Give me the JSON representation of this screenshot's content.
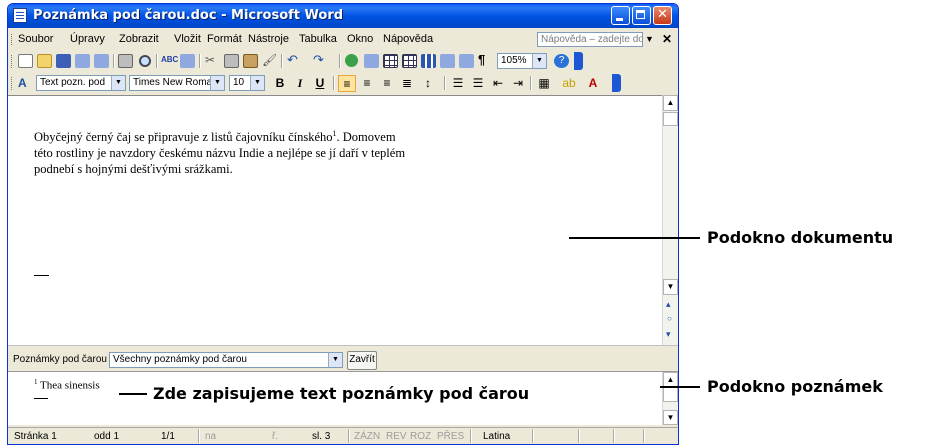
{
  "window": {
    "title": "Poznámka pod čarou.doc - Microsoft Word"
  },
  "menubar": {
    "items": [
      "Soubor",
      "Úpravy",
      "Zobrazit",
      "Vložit",
      "Formát",
      "Nástroje",
      "Tabulka",
      "Okno",
      "Nápověda"
    ],
    "help_placeholder": "Nápověda – zadejte dotaz"
  },
  "toolbar_standard": {
    "zoom": "105%"
  },
  "toolbar_formatting": {
    "style": "Text pozn. pod",
    "font": "Times New Roman",
    "size": "10",
    "bold": "B",
    "italic": "I",
    "underline": "U"
  },
  "document": {
    "line1_a": "Obyčejný černý čaj se připravuje z listů čajovníku čínského",
    "footnote_ref": "1",
    "line1_b": ". Domovem",
    "line2": "této rostliny je navzdory českému názvu Indie a nejlépe se jí daří v teplém",
    "line3": "podnebí s hojnými dešťivými srážkami."
  },
  "footnote_bar": {
    "label": "Poznámky pod čarou",
    "selector_value": "Všechny poznámky pod čarou",
    "close_label": "Zavřít"
  },
  "footnote_pane": {
    "number": "1",
    "text": " Thea sinensis"
  },
  "statusbar": {
    "page": "Stránka 1",
    "section": "odd 1",
    "pages": "1/1",
    "at": "na",
    "line": "ř.",
    "column": "sl. 3",
    "rec": "ZÁZN",
    "trk": "REV",
    "ext": "ROZ",
    "ovr": "PŘES",
    "language": "Latina"
  },
  "annotations": {
    "document_pane": "Podokno dokumentu",
    "footnote_pane": "Podokno poznámek",
    "footnote_text": "Zde zapisujeme text poznámky pod čarou"
  }
}
